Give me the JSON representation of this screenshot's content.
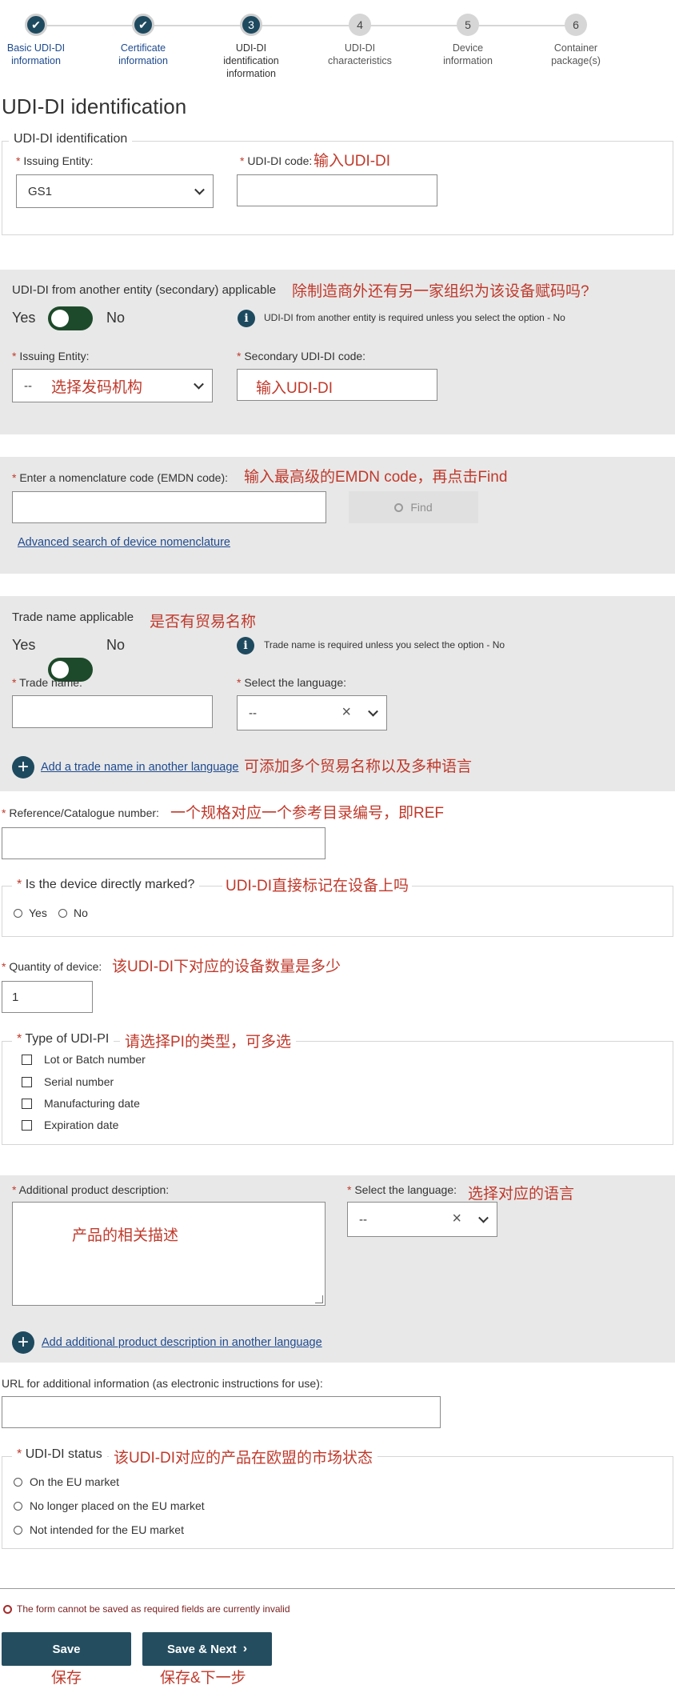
{
  "steps": [
    {
      "num": "✔",
      "label": "Basic UDI-DI\ninformation",
      "state": "done"
    },
    {
      "num": "✔",
      "label": "Certificate\ninformation",
      "state": "done"
    },
    {
      "num": "3",
      "label": "UDI-DI\nidentification\ninformation",
      "state": "current"
    },
    {
      "num": "4",
      "label": "UDI-DI\ncharacteristics",
      "state": "todo"
    },
    {
      "num": "5",
      "label": "Device\ninformation",
      "state": "todo"
    },
    {
      "num": "6",
      "label": "Container\npackage(s)",
      "state": "todo"
    }
  ],
  "page_title": "UDI-DI identification",
  "identification": {
    "legend": "UDI-DI identification",
    "issuing_label": "Issuing Entity:",
    "issuing_value": "GS1",
    "udi_code_label": "UDI-DI code:",
    "udi_code_note": "输入UDI-DI"
  },
  "secondary": {
    "title": "UDI-DI from another entity (secondary) applicable",
    "note": "除制造商外还有另一家组织为该设备赋码吗?",
    "yes": "Yes",
    "no": "No",
    "info": "UDI-DI from another entity is required unless you select the option - No",
    "issuing_label": "Issuing Entity:",
    "issuing_value": "--",
    "issuing_note": "选择发码机构",
    "code_label": "Secondary UDI-DI code:",
    "code_note": "输入UDI-DI"
  },
  "nomenclature": {
    "label": "Enter a nomenclature code (EMDN code):",
    "note": "输入最高级的EMDN code，再点击Find",
    "find": "Find",
    "advanced_link": "Advanced search of device nomenclature"
  },
  "trade": {
    "title": "Trade name applicable",
    "note": "是否有贸易名称",
    "yes": "Yes",
    "no": "No",
    "info": "Trade name is required unless you select the option - No",
    "name_label": "Trade name:",
    "lang_label": "Select the language:",
    "lang_value": "--",
    "add_link": "Add a trade name in another language",
    "add_note": "可添加多个贸易名称以及多种语言"
  },
  "reference": {
    "label": "Reference/Catalogue number:",
    "note": "一个规格对应一个参考目录编号，即REF"
  },
  "marked": {
    "legend": "Is the device directly marked?",
    "note": "UDI-DI直接标记在设备上吗",
    "yes": "Yes",
    "no": "No"
  },
  "quantity": {
    "label": "Quantity of device:",
    "note": "该UDI-DI下对应的设备数量是多少",
    "value": "1"
  },
  "udi_pi": {
    "legend": "Type of UDI-PI",
    "note": "请选择PI的类型，可多选",
    "options": [
      "Lot or Batch number",
      "Serial number",
      "Manufacturing date",
      "Expiration date"
    ]
  },
  "additional": {
    "label": "Additional product description:",
    "placeholder_note": "产品的相关描述",
    "lang_label": "Select the language:",
    "lang_note": "选择对应的语言",
    "lang_value": "--",
    "add_link": "Add additional product description in another language"
  },
  "url": {
    "label": "URL for additional information (as electronic instructions for use):"
  },
  "status": {
    "legend": "UDI-DI status",
    "note": "该UDI-DI对应的产品在欧盟的市场状态",
    "options": [
      "On the EU market",
      "No longer placed on the EU market",
      "Not intended for the EU market"
    ]
  },
  "error": "The form cannot be saved as required fields are currently invalid",
  "buttons": {
    "save": "Save",
    "save_next": "Save & Next",
    "save_note": "保存",
    "save_next_note": "保存&下一步"
  },
  "required_mark": "*"
}
